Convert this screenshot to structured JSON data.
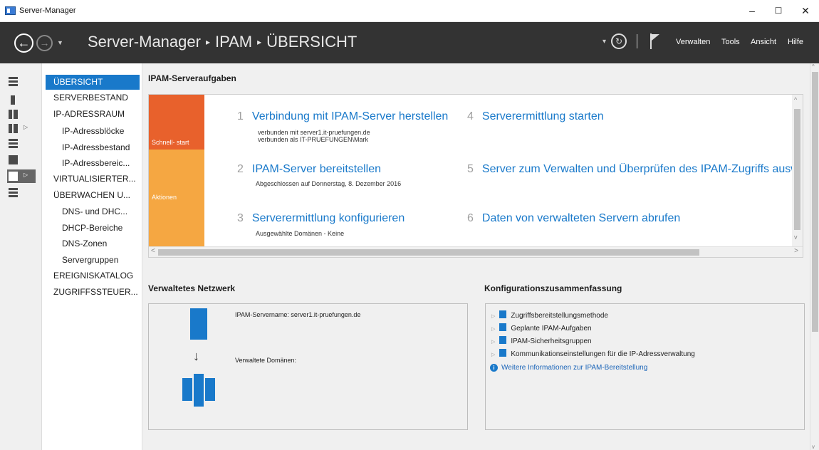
{
  "window": {
    "title": "Server-Manager",
    "minimize": "–",
    "maximize": "☐",
    "close": "✕"
  },
  "header": {
    "breadcrumb": [
      "Server-Manager",
      "IPAM",
      "ÜBERSICHT"
    ],
    "breadcrumb_sep": "▸",
    "menus": [
      "Verwalten",
      "Tools",
      "Ansicht",
      "Hilfe"
    ]
  },
  "nav": {
    "items": [
      {
        "label": "ÜBERSICHT",
        "level": 0,
        "selected": true
      },
      {
        "label": "SERVERBESTAND",
        "level": 0
      },
      {
        "label": "IP-ADRESSRAUM",
        "level": 0
      },
      {
        "label": "IP-Adressblöcke",
        "level": 1
      },
      {
        "label": "IP-Adressbestand",
        "level": 1
      },
      {
        "label": "IP-Adressbereic...",
        "level": 1
      },
      {
        "label": "VIRTUALISIERTER...",
        "level": 0
      },
      {
        "label": "ÜBERWACHEN U...",
        "level": 0
      },
      {
        "label": "DNS- und DHC...",
        "level": 1
      },
      {
        "label": "DHCP-Bereiche",
        "level": 1
      },
      {
        "label": "DNS-Zonen",
        "level": 1
      },
      {
        "label": "Servergruppen",
        "level": 1
      },
      {
        "label": "EREIGNISKATALOG",
        "level": 0
      },
      {
        "label": "ZUGRIFFSSTEUER...",
        "level": 0
      }
    ]
  },
  "tasks": {
    "heading": "IPAM-Serveraufgaben",
    "tiles": {
      "quickstart": "Schnell- start",
      "actions": "Aktionen"
    },
    "items": [
      {
        "num": "1",
        "label": "Verbindung mit IPAM-Server herstellen",
        "sub": [
          "verbunden mit server1.it-pruefungen.de",
          "verbunden als IT-PRUEFUNGEN\\Mark"
        ]
      },
      {
        "num": "2",
        "label": "IPAM-Server bereitstellen",
        "sub": [
          "Abgeschlossen auf Donnerstag, 8. Dezember 2016"
        ]
      },
      {
        "num": "3",
        "label": "Serverermittlung konfigurieren",
        "sub": [
          "Ausgewählte Domänen - Keine"
        ]
      },
      {
        "num": "4",
        "label": "Serverermittlung starten",
        "sub": []
      },
      {
        "num": "5",
        "label": "Server zum Verwalten und Überprüfen des IPAM-Zugriffs auswä",
        "sub": []
      },
      {
        "num": "6",
        "label": "Daten von verwalteten Servern abrufen",
        "sub": []
      }
    ]
  },
  "network": {
    "heading": "Verwaltetes Netzwerk",
    "server_name_label": "IPAM-Servername:",
    "server_name": "server1.it-pruefungen.de",
    "domains_label": "Verwaltete Domänen:"
  },
  "config": {
    "heading": "Konfigurationszusammenfassung",
    "items": [
      "Zugriffsbereitstellungsmethode",
      "Geplante IPAM-Aufgaben",
      "IPAM-Sicherheitsgruppen",
      "Kommunikationseinstellungen für die IP-Adressverwaltung"
    ],
    "link": "Weitere Informationen zur IPAM-Bereitstellung"
  },
  "colors": {
    "accent": "#1979ca",
    "header_bg": "#333333",
    "tile_quickstart": "#e8612c",
    "tile_actions": "#f5a742"
  }
}
